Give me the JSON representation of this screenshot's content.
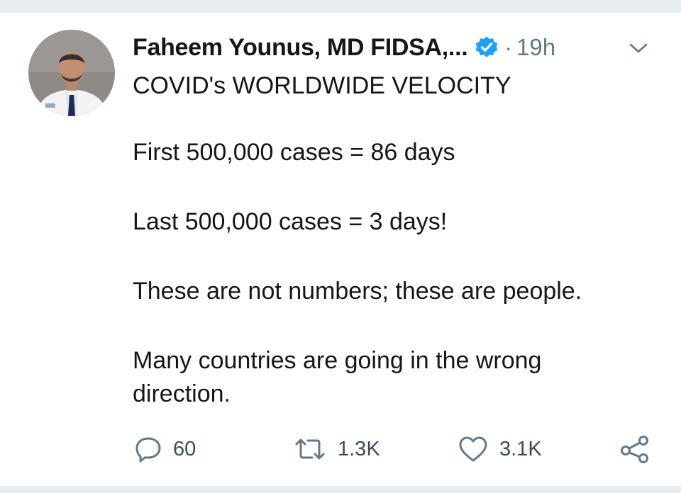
{
  "tweet": {
    "author_name": "Faheem Younus, MD FIDSA,...",
    "dot": "·",
    "time": "19h",
    "lines": [
      "COVID's WORLDWIDE VELOCITY",
      "First 500,000 cases = 86 days",
      "Last 500,000 cases = 3 days!",
      "These are not numbers; these are people.",
      "Many countries are going in the wrong direction."
    ]
  },
  "actions": {
    "reply_count": "60",
    "retweet_count": "1.3K",
    "like_count": "3.1K"
  },
  "icons": {
    "verified": "verified-badge-icon",
    "more": "chevron-down-icon",
    "reply": "reply-icon",
    "retweet": "retweet-icon",
    "like": "heart-icon",
    "share": "share-icon"
  },
  "colors": {
    "verified_blue": "#1da1f2",
    "secondary_text": "#657786",
    "divider_gray": "#e6ecf0"
  }
}
